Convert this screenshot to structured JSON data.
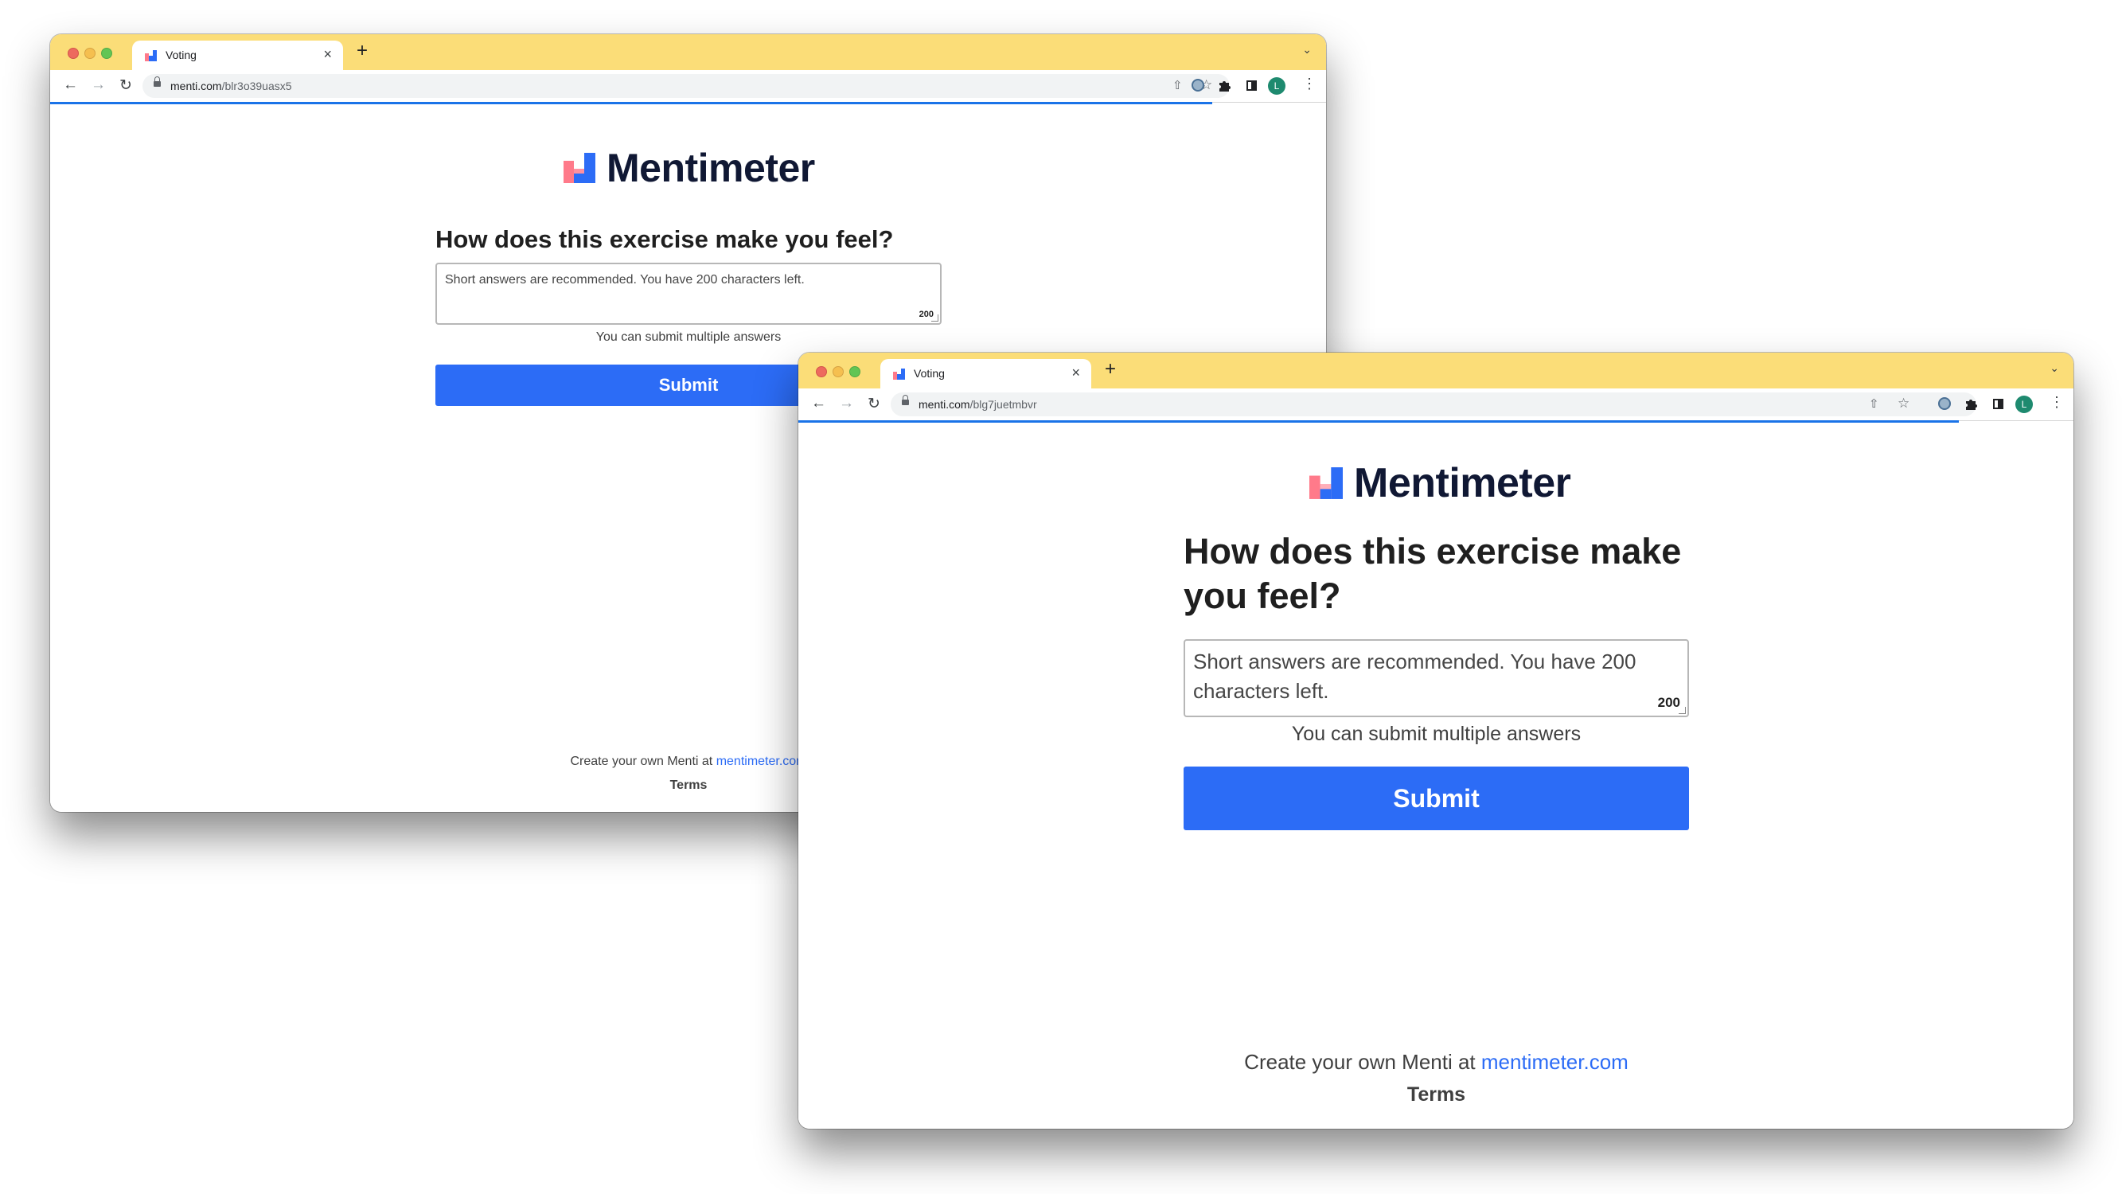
{
  "brand": {
    "name": "Mentimeter"
  },
  "windows": [
    {
      "tab": {
        "title": "Voting",
        "close": "×",
        "new_tab": "+"
      },
      "toolbar": {
        "url_host": "menti.com",
        "url_path": "/blr3o39uasx5",
        "avatar_letter": "L"
      },
      "page": {
        "question": "How does this exercise make you feel?",
        "answer_placeholder": "Short answers are recommended. You have 200 characters left.",
        "char_count": "200",
        "hint": "You can submit multiple answers",
        "submit_label": "Submit",
        "footer_text": "Create your own Menti at ",
        "footer_link": "mentimeter.com",
        "terms": "Terms"
      }
    },
    {
      "tab": {
        "title": "Voting",
        "close": "×",
        "new_tab": "+"
      },
      "toolbar": {
        "url_host": "menti.com",
        "url_path": "/blg7juetmbvr",
        "avatar_letter": "L"
      },
      "page": {
        "question": "How does this exercise make you feel?",
        "answer_placeholder": "Short answers are recommended. You have 200 characters left.",
        "char_count": "200",
        "hint": "You can submit multiple answers",
        "submit_label": "Submit",
        "footer_text": "Create your own Menti at ",
        "footer_link": "mentimeter.com",
        "terms": "Terms"
      }
    }
  ],
  "colors": {
    "tab_strip": "#fbdd78",
    "submit": "#2c6cf6",
    "link": "#2c6cf6",
    "avatar": "#1e8a6f"
  }
}
